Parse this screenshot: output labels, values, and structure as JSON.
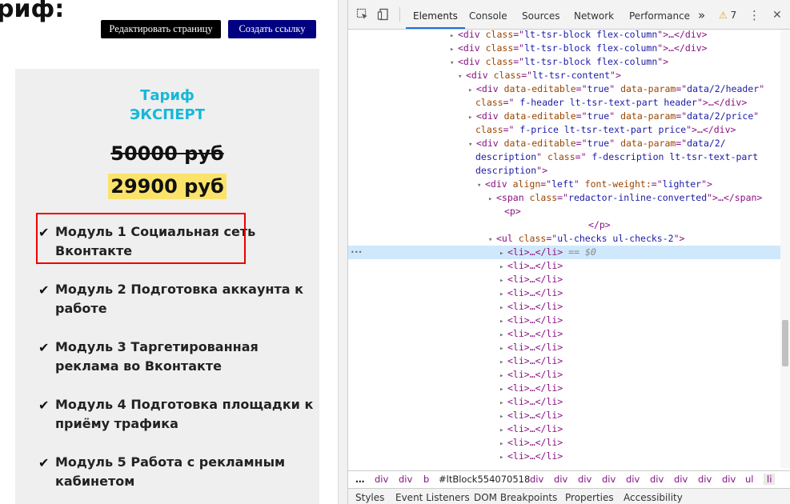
{
  "page": {
    "heading": "риф:",
    "edit_button": "Редактировать страницу",
    "link_button": "Создать ссылку",
    "tariff_line1": "Тариф",
    "tariff_line2": "ЭКСПЕРТ",
    "old_price": "50000 руб",
    "new_price": "29900 руб",
    "check_glyph": "✔",
    "modules": [
      "Модуль 1 Социальная сеть Вконтакте",
      "Модуль 2 Подготовка аккаунта к работе",
      "Модуль 3 Таргетированная реклама во Вконтакте",
      "Модуль 4 Подготовка площадки к приёму трафика",
      "Модуль 5 Работа с рекламным кабинетом"
    ],
    "colors": {
      "tariff": "#16b8d8",
      "price_highlight": "#fbe36a",
      "highlight_border": "#e00000",
      "link_button": "#000080"
    }
  },
  "devtools": {
    "tabs": [
      "Elements",
      "Console",
      "Sources",
      "Network",
      "Performance"
    ],
    "active_tab": "Elements",
    "more_tabs": "»",
    "warning_icon": "⚠",
    "warning_count": "7",
    "menu_icon": "⋮",
    "close_icon": "✕",
    "icons": {
      "inspect": "inspect-element-icon",
      "device": "device-toolbar-icon"
    },
    "dom_lines": [
      {
        "toggle": "▸",
        "parts": [
          [
            "tg",
            "<div "
          ],
          [
            "an",
            "class"
          ],
          [
            "tg",
            "=\""
          ],
          [
            "av",
            "lt-tsr-block flex-column"
          ],
          [
            "tg",
            "\">…</div>"
          ]
        ]
      },
      {
        "toggle": "▸",
        "parts": [
          [
            "tg",
            "<div "
          ],
          [
            "an",
            "class"
          ],
          [
            "tg",
            "=\""
          ],
          [
            "av",
            "lt-tsr-block flex-column"
          ],
          [
            "tg",
            "\">…</div>"
          ]
        ]
      },
      {
        "toggle": "▾",
        "parts": [
          [
            "tg",
            "<div "
          ],
          [
            "an",
            "class"
          ],
          [
            "tg",
            "=\""
          ],
          [
            "av",
            "lt-tsr-block flex-column"
          ],
          [
            "tg",
            "\">"
          ]
        ]
      },
      {
        "toggle": "▾",
        "parts": [
          [
            "tg",
            "<div "
          ],
          [
            "an",
            "class"
          ],
          [
            "tg",
            "=\""
          ],
          [
            "av",
            "lt-tsr-content"
          ],
          [
            "tg",
            "\">"
          ]
        ]
      },
      {
        "toggle": "▸",
        "parts": [
          [
            "tg",
            "<div "
          ],
          [
            "an",
            "data-editable"
          ],
          [
            "tg",
            "=\""
          ],
          [
            "av",
            "true"
          ],
          [
            "tg",
            "\" "
          ],
          [
            "an",
            "data-param"
          ],
          [
            "tg",
            "=\""
          ],
          [
            "av",
            "data/2/header"
          ],
          [
            "tg",
            "\""
          ]
        ]
      },
      {
        "toggle": "",
        "parts": [
          [
            "an",
            "class"
          ],
          [
            "tg",
            "=\""
          ],
          [
            "av",
            "  f-header lt-tsr-text-part header"
          ],
          [
            "tg",
            "\">…</div>"
          ]
        ]
      },
      {
        "toggle": "▸",
        "parts": [
          [
            "tg",
            "<div "
          ],
          [
            "an",
            "data-editable"
          ],
          [
            "tg",
            "=\""
          ],
          [
            "av",
            "true"
          ],
          [
            "tg",
            "\" "
          ],
          [
            "an",
            "data-param"
          ],
          [
            "tg",
            "=\""
          ],
          [
            "av",
            "data/2/price"
          ],
          [
            "tg",
            "\""
          ]
        ]
      },
      {
        "toggle": "",
        "parts": [
          [
            "an",
            "class"
          ],
          [
            "tg",
            "=\""
          ],
          [
            "av",
            "  f-price lt-tsr-text-part price"
          ],
          [
            "tg",
            "\">…</div>"
          ]
        ]
      },
      {
        "toggle": "▾",
        "parts": [
          [
            "tg",
            "<div "
          ],
          [
            "an",
            "data-editable"
          ],
          [
            "tg",
            "=\""
          ],
          [
            "av",
            "true"
          ],
          [
            "tg",
            "\" "
          ],
          [
            "an",
            "data-param"
          ],
          [
            "tg",
            "=\""
          ],
          [
            "av",
            "data/2/"
          ]
        ]
      },
      {
        "toggle": "",
        "parts": [
          [
            "av",
            "description"
          ],
          [
            "tg",
            "\" "
          ],
          [
            "an",
            "class"
          ],
          [
            "tg",
            "=\""
          ],
          [
            "av",
            "  f-description lt-tsr-text-part"
          ]
        ]
      },
      {
        "toggle": "",
        "parts": [
          [
            "av",
            "description"
          ],
          [
            "tg",
            "\">"
          ]
        ]
      },
      {
        "toggle": "▾",
        "parts": [
          [
            "tg",
            "<div "
          ],
          [
            "an",
            "align"
          ],
          [
            "tg",
            "=\""
          ],
          [
            "av",
            "left"
          ],
          [
            "tg",
            "\" "
          ],
          [
            "an",
            "font-weight:"
          ],
          [
            "tg",
            "=\""
          ],
          [
            "av",
            "lighter"
          ],
          [
            "tg",
            "\">"
          ]
        ]
      },
      {
        "toggle": "▸",
        "parts": [
          [
            "tg",
            "<span "
          ],
          [
            "an",
            "class"
          ],
          [
            "tg",
            "=\""
          ],
          [
            "av",
            "redactor-inline-converted"
          ],
          [
            "tg",
            "\">…</span>"
          ]
        ]
      },
      {
        "toggle": "",
        "parts": [
          [
            "tg",
            "<p>"
          ]
        ]
      },
      {
        "toggle": "",
        "parts": [
          [
            "tg",
            "</p>"
          ]
        ]
      },
      {
        "toggle": "▾",
        "parts": [
          [
            "tg",
            "<ul "
          ],
          [
            "an",
            "class"
          ],
          [
            "tg",
            "=\""
          ],
          [
            "av",
            "ul-checks ul-checks-2"
          ],
          [
            "tg",
            "\">"
          ]
        ]
      },
      {
        "toggle": "▸",
        "parts": [
          [
            "tg",
            "<li>…</li>"
          ]
        ],
        "suffix": " == $0"
      },
      {
        "toggle": "▸",
        "parts": [
          [
            "tg",
            "<li>…</li>"
          ]
        ]
      },
      {
        "toggle": "▸",
        "parts": [
          [
            "tg",
            "<li>…</li>"
          ]
        ]
      },
      {
        "toggle": "▸",
        "parts": [
          [
            "tg",
            "<li>…</li>"
          ]
        ]
      },
      {
        "toggle": "▸",
        "parts": [
          [
            "tg",
            "<li>…</li>"
          ]
        ]
      },
      {
        "toggle": "▸",
        "parts": [
          [
            "tg",
            "<li>…</li>"
          ]
        ]
      },
      {
        "toggle": "▸",
        "parts": [
          [
            "tg",
            "<li>…</li>"
          ]
        ]
      },
      {
        "toggle": "▸",
        "parts": [
          [
            "tg",
            "<li>…</li>"
          ]
        ]
      },
      {
        "toggle": "▸",
        "parts": [
          [
            "tg",
            "<li>…</li>"
          ]
        ]
      },
      {
        "toggle": "▸",
        "parts": [
          [
            "tg",
            "<li>…</li>"
          ]
        ]
      },
      {
        "toggle": "▸",
        "parts": [
          [
            "tg",
            "<li>…</li>"
          ]
        ]
      },
      {
        "toggle": "▸",
        "parts": [
          [
            "tg",
            "<li>…</li>"
          ]
        ]
      },
      {
        "toggle": "▸",
        "parts": [
          [
            "tg",
            "<li>…</li>"
          ]
        ]
      },
      {
        "toggle": "▸",
        "parts": [
          [
            "tg",
            "<li>…</li>"
          ]
        ]
      },
      {
        "toggle": "▸",
        "parts": [
          [
            "tg",
            "<li>…</li>"
          ]
        ]
      },
      {
        "toggle": "▸",
        "parts": [
          [
            "tg",
            "<li>…</li>"
          ]
        ]
      }
    ],
    "selected_line": 16,
    "gutter_dots": "•••",
    "breadcrumbs": [
      "…",
      "div",
      "div",
      "b",
      "#ltBlock554070518",
      "div",
      "div",
      "div",
      "div",
      "div",
      "div",
      "div",
      "div",
      "div",
      "ul",
      "li"
    ],
    "bottom_tabs": [
      "Styles",
      "Event Listeners",
      "DOM Breakpoints",
      "Properties",
      "Accessibility"
    ]
  }
}
